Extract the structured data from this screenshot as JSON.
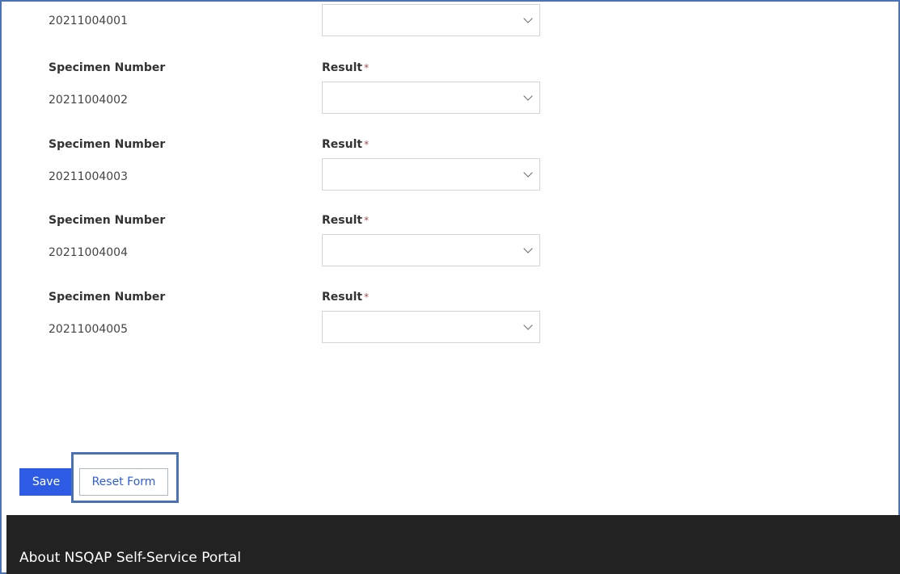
{
  "form": {
    "top_specimen_value": "20211004001",
    "rows": [
      {
        "specimen_label": "Specimen Number",
        "specimen_value": "20211004002",
        "result_label": "Result",
        "required_mark": "*",
        "result_value": ""
      },
      {
        "specimen_label": "Specimen Number",
        "specimen_value": "20211004003",
        "result_label": "Result",
        "required_mark": "*",
        "result_value": ""
      },
      {
        "specimen_label": "Specimen Number",
        "specimen_value": "20211004004",
        "result_label": "Result",
        "required_mark": "*",
        "result_value": ""
      },
      {
        "specimen_label": "Specimen Number",
        "specimen_value": "20211004005",
        "result_label": "Result",
        "required_mark": "*",
        "result_value": ""
      }
    ]
  },
  "buttons": {
    "save_label": "Save",
    "reset_label": "Reset Form"
  },
  "footer": {
    "about_label": "About NSQAP Self-Service Portal"
  },
  "icons": {
    "dropdown": "chevron-down-icon"
  },
  "colors": {
    "primary": "#2e5be6",
    "highlight_border": "#4a72b8",
    "footer_bg": "#222222",
    "required": "#a34b4b"
  }
}
